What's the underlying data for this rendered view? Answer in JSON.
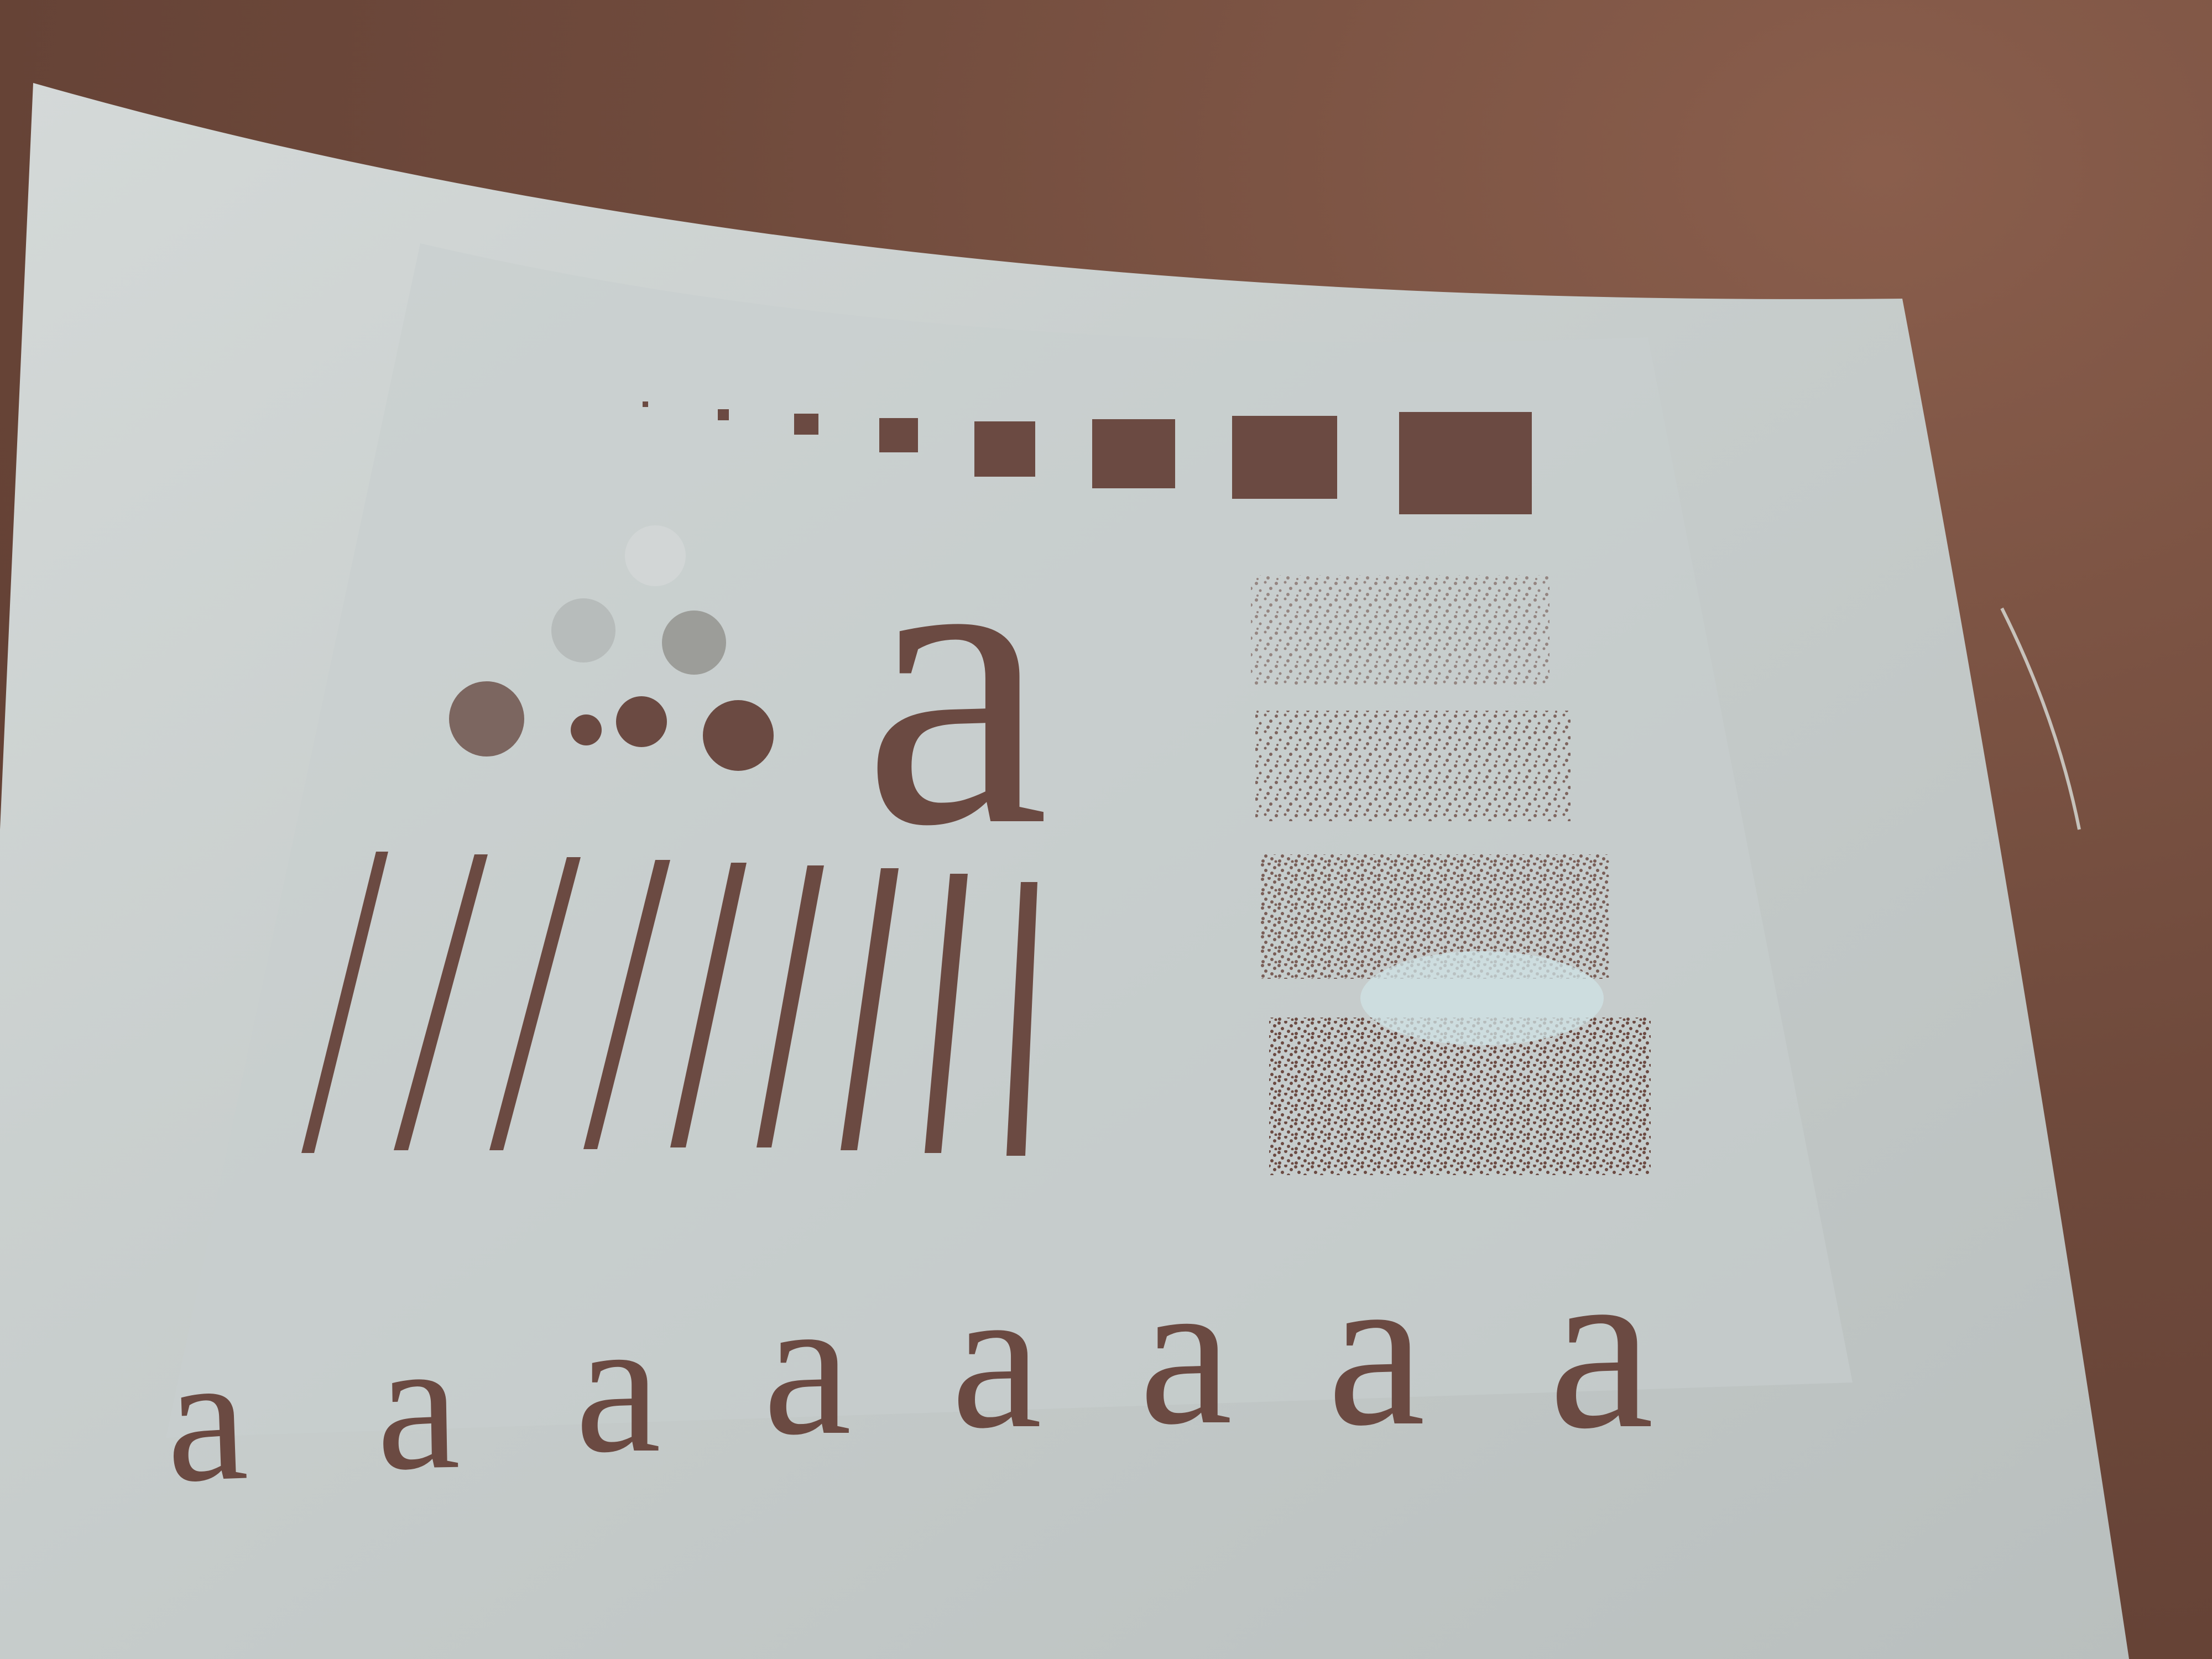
{
  "scene": {
    "description_kind": "photo of curved printed test chart",
    "paper_color": "#c9cfcf",
    "ink_color": "#6b4a42",
    "background_color": "#6e4a3e"
  },
  "chart": {
    "big_letter": "a",
    "letter_row": [
      "a",
      "a",
      "a",
      "a",
      "a",
      "a",
      "a",
      "a"
    ]
  }
}
